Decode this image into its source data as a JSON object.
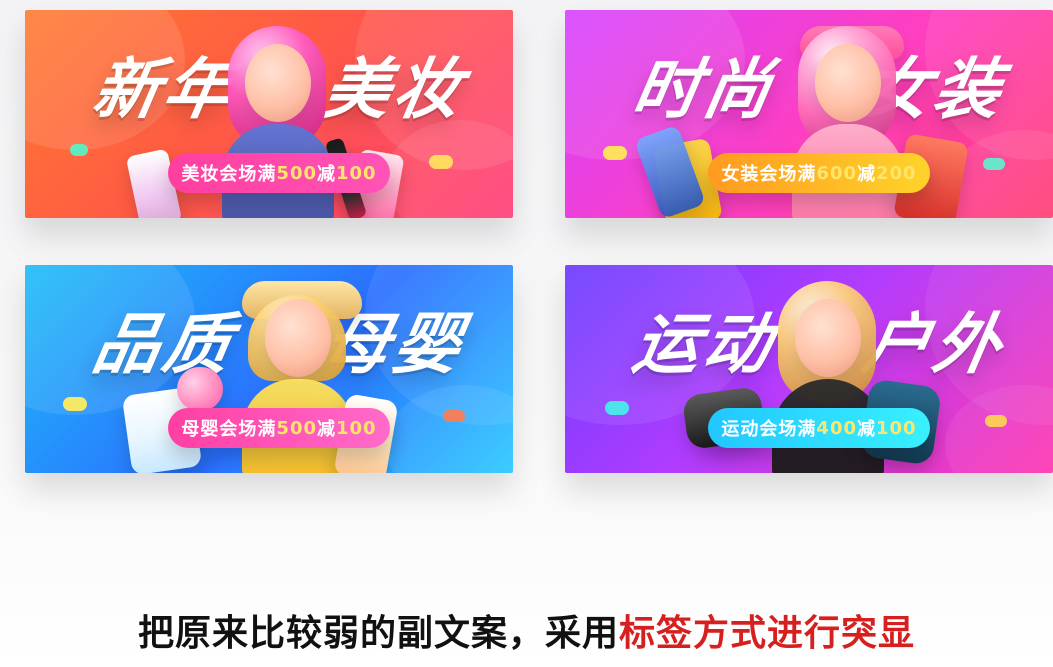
{
  "banners": [
    {
      "title_left": "新年",
      "title_right": "美妆",
      "promo_prefix": "美妆会场满",
      "promo_amount_1": "500",
      "promo_mid": "减",
      "promo_amount_2": "100",
      "theme": "orange-pink"
    },
    {
      "title_left": "时尚",
      "title_right": "女装",
      "promo_prefix": "女装会场满",
      "promo_amount_1": "600",
      "promo_mid": "减",
      "promo_amount_2": "200",
      "theme": "purple-pink"
    },
    {
      "title_left": "品质",
      "title_right": "母婴",
      "promo_prefix": "母婴会场满",
      "promo_amount_1": "500",
      "promo_mid": "减",
      "promo_amount_2": "100",
      "theme": "blue"
    },
    {
      "title_left": "运动",
      "title_right": "户外",
      "promo_prefix": "运动会场满",
      "promo_amount_1": "400",
      "promo_mid": "减",
      "promo_amount_2": "100",
      "theme": "purple"
    }
  ],
  "caption": {
    "prefix": "把原来比较弱的副文案，采用",
    "highlight": "标签方式进行突显"
  },
  "colors": {
    "caption_text": "#111111",
    "caption_highlight": "#d61f1f"
  }
}
